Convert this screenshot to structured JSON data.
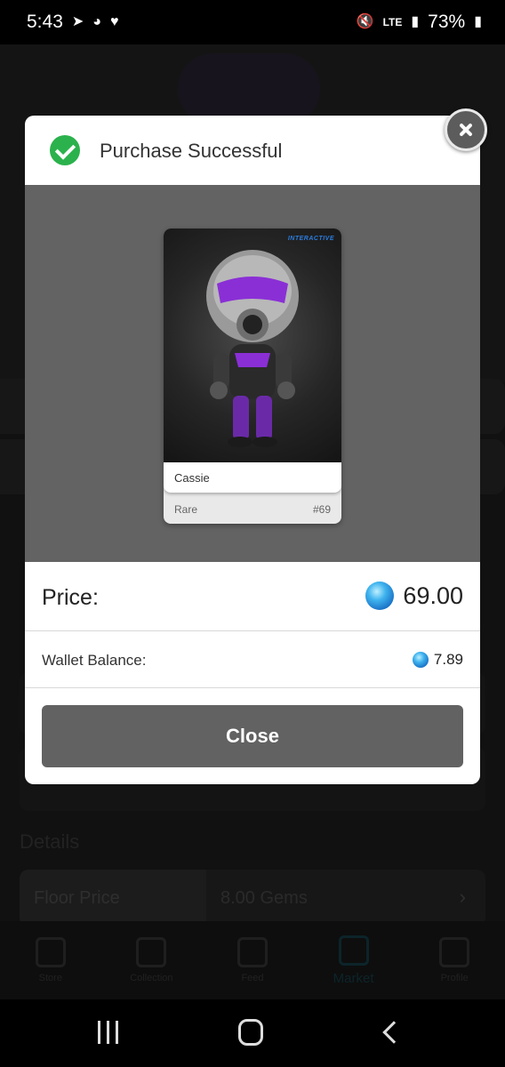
{
  "status_bar": {
    "time": "5:43",
    "network": "LTE",
    "battery": "73%",
    "icons": [
      "telegram-icon",
      "messenger-icon",
      "heart-icon",
      "mute-icon",
      "volte-icon",
      "signal-icon",
      "battery-icon"
    ]
  },
  "background_page": {
    "details_title": "Details",
    "floor_price_label": "Floor Price",
    "floor_price_value": "8.00 Gems",
    "tabs": [
      {
        "label": "Store",
        "icon": "tag-icon"
      },
      {
        "label": "Collection",
        "icon": "archive-icon"
      },
      {
        "label": "Feed",
        "icon": "feed-icon"
      },
      {
        "label": "Market",
        "icon": "market-icon",
        "active": true
      },
      {
        "label": "Profile",
        "icon": "profile-icon"
      }
    ]
  },
  "modal": {
    "title": "Purchase Successful",
    "card": {
      "brand": "INTERACTIVE",
      "name": "Cassie",
      "rarity": "Rare",
      "edition": "#69"
    },
    "price_label": "Price:",
    "price_value": "69.00",
    "wallet_label": "Wallet Balance:",
    "wallet_value": "7.89",
    "close_label": "Close"
  },
  "colors": {
    "success": "#2bb24c",
    "gem": "#3fb3ee",
    "button": "#626262"
  }
}
